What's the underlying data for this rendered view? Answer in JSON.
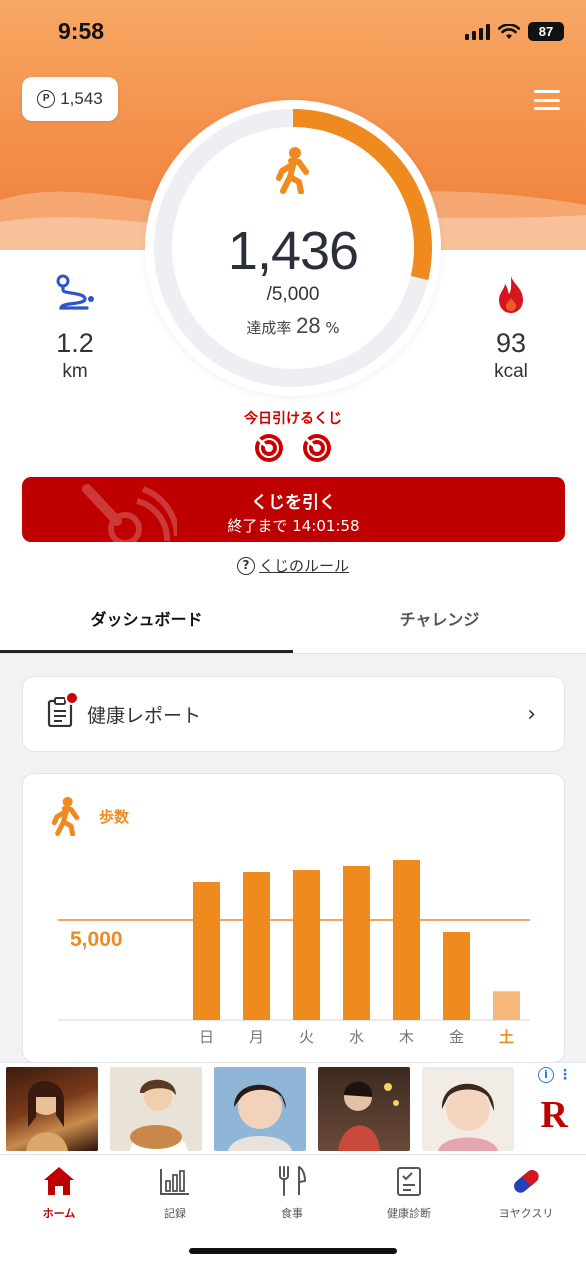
{
  "status_bar": {
    "time": "9:58",
    "battery": "87"
  },
  "points": {
    "value": "1,543",
    "icon": "P"
  },
  "steps": {
    "count": "1,436",
    "goal": "/5,000",
    "rate_label": "達成率",
    "rate_value": "28",
    "rate_unit": "%",
    "progress_fraction": 0.287
  },
  "distance": {
    "value": "1.2",
    "unit": "km"
  },
  "calories": {
    "value": "93",
    "unit": "kcal"
  },
  "lottery": {
    "label": "今日引けるくじ",
    "tickets_available": 2,
    "button_title": "くじを引く",
    "button_sub": "終了まで 14:01:58",
    "rules_icon": "?",
    "rules_link": "くじのルール"
  },
  "tabs": [
    {
      "label": "ダッシュボード",
      "active": true
    },
    {
      "label": "チャレンジ",
      "active": false
    }
  ],
  "report": {
    "label": "健康レポート",
    "chevron": "›"
  },
  "chart": {
    "title": "歩数",
    "goal_label": "5,000"
  },
  "chart_data": {
    "type": "bar",
    "categories": [
      "日",
      "月",
      "火",
      "水",
      "木",
      "金",
      "土"
    ],
    "values": [
      6900,
      7400,
      7500,
      7700,
      8000,
      4400,
      1436
    ],
    "goal": 5000,
    "ylim": [
      0,
      8800
    ],
    "highlight_category": "土",
    "colors": {
      "bar": "#ef8a1e",
      "bar_today": "#f6b77a",
      "goal_line": "#f4a55c"
    }
  },
  "ads": {
    "info_icon": "i",
    "logo": "R"
  },
  "bottom_nav": [
    {
      "label": "ホーム",
      "icon": "home-icon",
      "active": true
    },
    {
      "label": "記録",
      "icon": "bar-chart-icon",
      "active": false
    },
    {
      "label": "食事",
      "icon": "fork-knife-icon",
      "active": false
    },
    {
      "label": "健康診断",
      "icon": "checklist-icon",
      "active": false
    },
    {
      "label": "ヨヤクスリ",
      "icon": "capsule-icon",
      "active": false
    }
  ]
}
